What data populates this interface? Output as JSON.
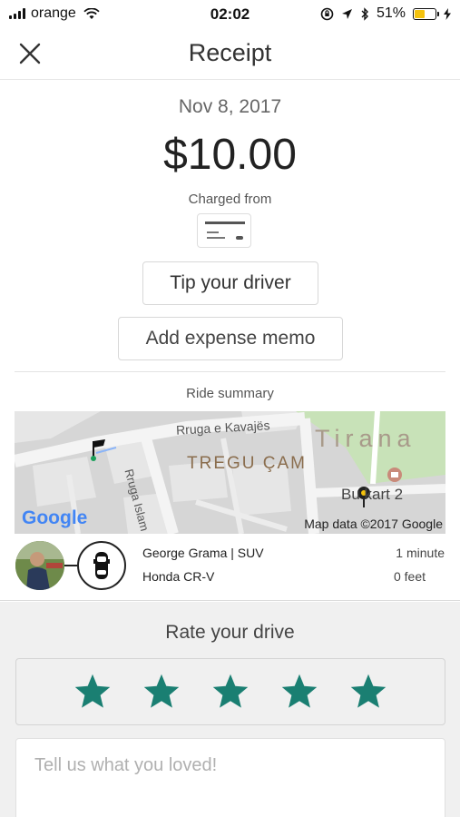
{
  "status_bar": {
    "carrier": "orange",
    "time": "02:02",
    "battery": "51%"
  },
  "header": {
    "title": "Receipt"
  },
  "receipt": {
    "date": "Nov 8, 2017",
    "amount": "$10.00",
    "charged_from": "Charged from"
  },
  "actions": {
    "tip_label": "Tip your driver",
    "memo_label": "Add expense memo"
  },
  "summary": {
    "label": "Ride summary",
    "map": {
      "street_1": "Rruga e Kavajës",
      "street_2": "Rruga Islam A",
      "district": "TREGU ÇAM",
      "city": "Tirana",
      "poi": "Bu kart 2",
      "provider": "Google",
      "attribution": "Map data ©2017 Google"
    }
  },
  "driver": {
    "name": "George Grama | SUV",
    "car": "Honda CR-V",
    "eta": "1 minute",
    "distance": "0 feet"
  },
  "rating": {
    "title": "Rate your drive",
    "stars": 5,
    "star_color": "#1a7f72",
    "feedback_placeholder": "Tell us what you loved!"
  }
}
